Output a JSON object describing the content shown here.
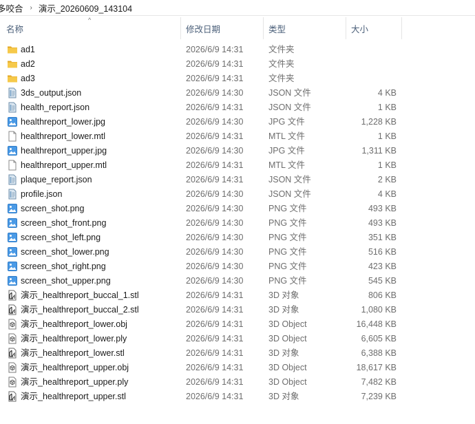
{
  "breadcrumb": [
    "多咬合",
    "演示_20260609_143104"
  ],
  "header": {
    "name": "名称",
    "date": "修改日期",
    "type": "类型",
    "size": "大小",
    "sort_indicator": "^"
  },
  "files": [
    {
      "name": "ad1",
      "date": "2026/6/9 14:31",
      "type": "文件夹",
      "size": "",
      "icon": "folder-icon"
    },
    {
      "name": "ad2",
      "date": "2026/6/9 14:31",
      "type": "文件夹",
      "size": "",
      "icon": "folder-icon"
    },
    {
      "name": "ad3",
      "date": "2026/6/9 14:31",
      "type": "文件夹",
      "size": "",
      "icon": "folder-icon"
    },
    {
      "name": "3ds_output.json",
      "date": "2026/6/9 14:30",
      "type": "JSON 文件",
      "size": "4 KB",
      "icon": "json-file-icon"
    },
    {
      "name": "health_report.json",
      "date": "2026/6/9 14:31",
      "type": "JSON 文件",
      "size": "1 KB",
      "icon": "json-file-icon"
    },
    {
      "name": "healthreport_lower.jpg",
      "date": "2026/6/9 14:30",
      "type": "JPG 文件",
      "size": "1,228 KB",
      "icon": "image-file-icon"
    },
    {
      "name": "healthreport_lower.mtl",
      "date": "2026/6/9 14:31",
      "type": "MTL 文件",
      "size": "1 KB",
      "icon": "blank-file-icon"
    },
    {
      "name": "healthreport_upper.jpg",
      "date": "2026/6/9 14:30",
      "type": "JPG 文件",
      "size": "1,311 KB",
      "icon": "image-file-icon"
    },
    {
      "name": "healthreport_upper.mtl",
      "date": "2026/6/9 14:31",
      "type": "MTL 文件",
      "size": "1 KB",
      "icon": "blank-file-icon"
    },
    {
      "name": "plaque_report.json",
      "date": "2026/6/9 14:31",
      "type": "JSON 文件",
      "size": "2 KB",
      "icon": "json-file-icon"
    },
    {
      "name": "profile.json",
      "date": "2026/6/9 14:30",
      "type": "JSON 文件",
      "size": "4 KB",
      "icon": "json-file-icon"
    },
    {
      "name": "screen_shot.png",
      "date": "2026/6/9 14:30",
      "type": "PNG 文件",
      "size": "493 KB",
      "icon": "image-file-icon"
    },
    {
      "name": "screen_shot_front.png",
      "date": "2026/6/9 14:30",
      "type": "PNG 文件",
      "size": "493 KB",
      "icon": "image-file-icon"
    },
    {
      "name": "screen_shot_left.png",
      "date": "2026/6/9 14:30",
      "type": "PNG 文件",
      "size": "351 KB",
      "icon": "image-file-icon"
    },
    {
      "name": "screen_shot_lower.png",
      "date": "2026/6/9 14:30",
      "type": "PNG 文件",
      "size": "516 KB",
      "icon": "image-file-icon"
    },
    {
      "name": "screen_shot_right.png",
      "date": "2026/6/9 14:30",
      "type": "PNG 文件",
      "size": "423 KB",
      "icon": "image-file-icon"
    },
    {
      "name": "screen_shot_upper.png",
      "date": "2026/6/9 14:30",
      "type": "PNG 文件",
      "size": "545 KB",
      "icon": "image-file-icon"
    },
    {
      "name": "演示_healthreport_buccal_1.stl",
      "date": "2026/6/9 14:31",
      "type": "3D 对象",
      "size": "806 KB",
      "icon": "stl-file-icon"
    },
    {
      "name": "演示_healthreport_buccal_2.stl",
      "date": "2026/6/9 14:31",
      "type": "3D 对象",
      "size": "1,080 KB",
      "icon": "stl-file-icon"
    },
    {
      "name": "演示_healthreport_lower.obj",
      "date": "2026/6/9 14:31",
      "type": "3D Object",
      "size": "16,448 KB",
      "icon": "3d-object-file-icon"
    },
    {
      "name": "演示_healthreport_lower.ply",
      "date": "2026/6/9 14:31",
      "type": "3D Object",
      "size": "6,605 KB",
      "icon": "3d-object-file-icon"
    },
    {
      "name": "演示_healthreport_lower.stl",
      "date": "2026/6/9 14:31",
      "type": "3D 对象",
      "size": "6,388 KB",
      "icon": "stl-file-icon"
    },
    {
      "name": "演示_healthreport_upper.obj",
      "date": "2026/6/9 14:31",
      "type": "3D Object",
      "size": "18,617 KB",
      "icon": "3d-object-file-icon"
    },
    {
      "name": "演示_healthreport_upper.ply",
      "date": "2026/6/9 14:31",
      "type": "3D Object",
      "size": "7,482 KB",
      "icon": "3d-object-file-icon"
    },
    {
      "name": "演示_healthreport_upper.stl",
      "date": "2026/6/9 14:31",
      "type": "3D 对象",
      "size": "7,239 KB",
      "icon": "stl-file-icon"
    }
  ],
  "colors": {
    "folder": "#f6c94a",
    "folder_dark": "#e3a826",
    "json_file": "#7fa7c9",
    "image_file": "#3b8ee0",
    "header_text": "#4c607a",
    "secondary_text": "#6d6d6d"
  }
}
